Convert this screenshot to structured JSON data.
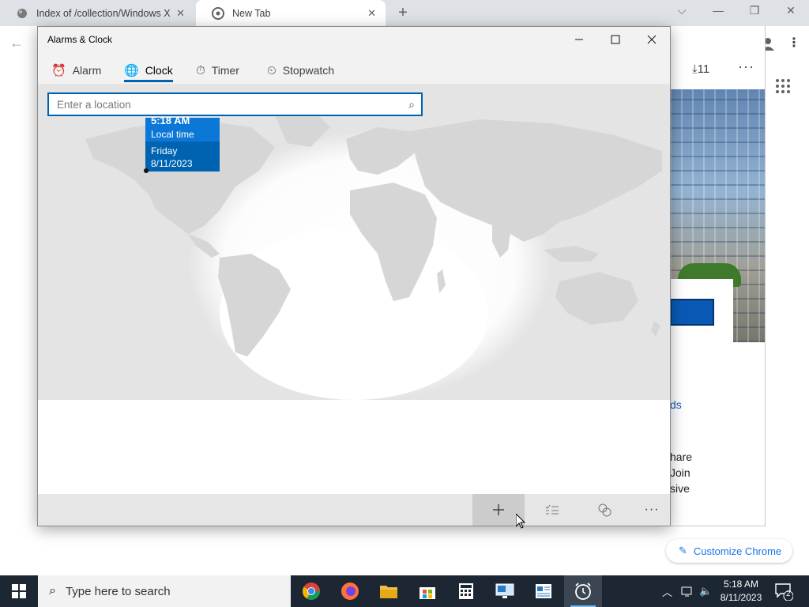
{
  "browser": {
    "tabs": [
      {
        "title": "Index of /collection/Windows XP"
      },
      {
        "title": "New Tab"
      }
    ],
    "toolbar": {
      "downloads_count": "11",
      "more": "⋮"
    },
    "background_text": {
      "link_fragment": "ds",
      "line1": "hare",
      "line2": "Join",
      "line3": "sive"
    },
    "customize_label": "Customize Chrome"
  },
  "app": {
    "title": "Alarms & Clock",
    "nav": [
      {
        "label": "Alarm",
        "icon": "alarm-clock-icon"
      },
      {
        "label": "Clock",
        "icon": "world-clock-icon",
        "active": true
      },
      {
        "label": "Timer",
        "icon": "timer-icon"
      },
      {
        "label": "Stopwatch",
        "icon": "stopwatch-icon"
      }
    ],
    "search": {
      "placeholder": "Enter a location",
      "value": ""
    },
    "local_clock": {
      "time": "5:18 AM",
      "label": "Local time",
      "day": "Friday",
      "date": "8/11/2023"
    },
    "command_bar": [
      {
        "name": "add-new-clock-button",
        "icon": "plus-icon"
      },
      {
        "name": "select-clocks-button",
        "icon": "list-select-icon"
      },
      {
        "name": "compare-button",
        "icon": "compare-clocks-icon"
      },
      {
        "name": "more-options-button",
        "icon": "more-icon"
      }
    ]
  },
  "taskbar": {
    "search_placeholder": "Type here to search",
    "apps": [
      "chrome",
      "firefox",
      "file-explorer",
      "microsoft-store",
      "calculator",
      "remote-desktop",
      "news",
      "alarms-clock"
    ],
    "clock_time": "5:18 AM",
    "clock_date": "8/11/2023",
    "notification_count": "2"
  },
  "colors": {
    "accent": "#0063b1",
    "accent_light": "#0b78d7",
    "taskbar": "#1c2733",
    "chrome_tabbar": "#dee1e6"
  }
}
